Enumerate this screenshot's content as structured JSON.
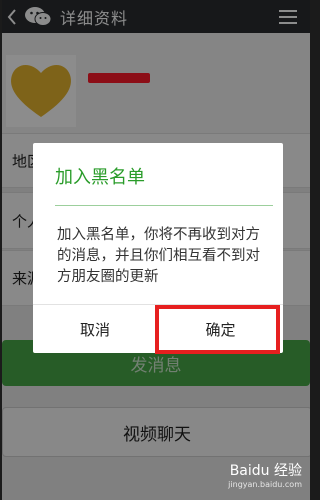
{
  "titlebar": {
    "title": "详细资料"
  },
  "rows": [
    {
      "label": "地区"
    },
    {
      "label": "个人相册"
    },
    {
      "label": "来源"
    }
  ],
  "buttons": {
    "send": "发消息",
    "video": "视频聊天"
  },
  "dialog": {
    "title": "加入黑名单",
    "message": "加入黑名单，你将不再收到对方的消息，并且你们相互看不到对方朋友圈的更新",
    "cancel": "取消",
    "confirm": "确定"
  },
  "watermark": {
    "brand": "Baidu 经验",
    "url": "jingyan.baidu.com"
  },
  "colors": {
    "accent_green": "#48a847",
    "dialog_title": "#2a9c2a",
    "highlight_red": "#e61f1f",
    "redacted_name": "#ff1a2a"
  }
}
